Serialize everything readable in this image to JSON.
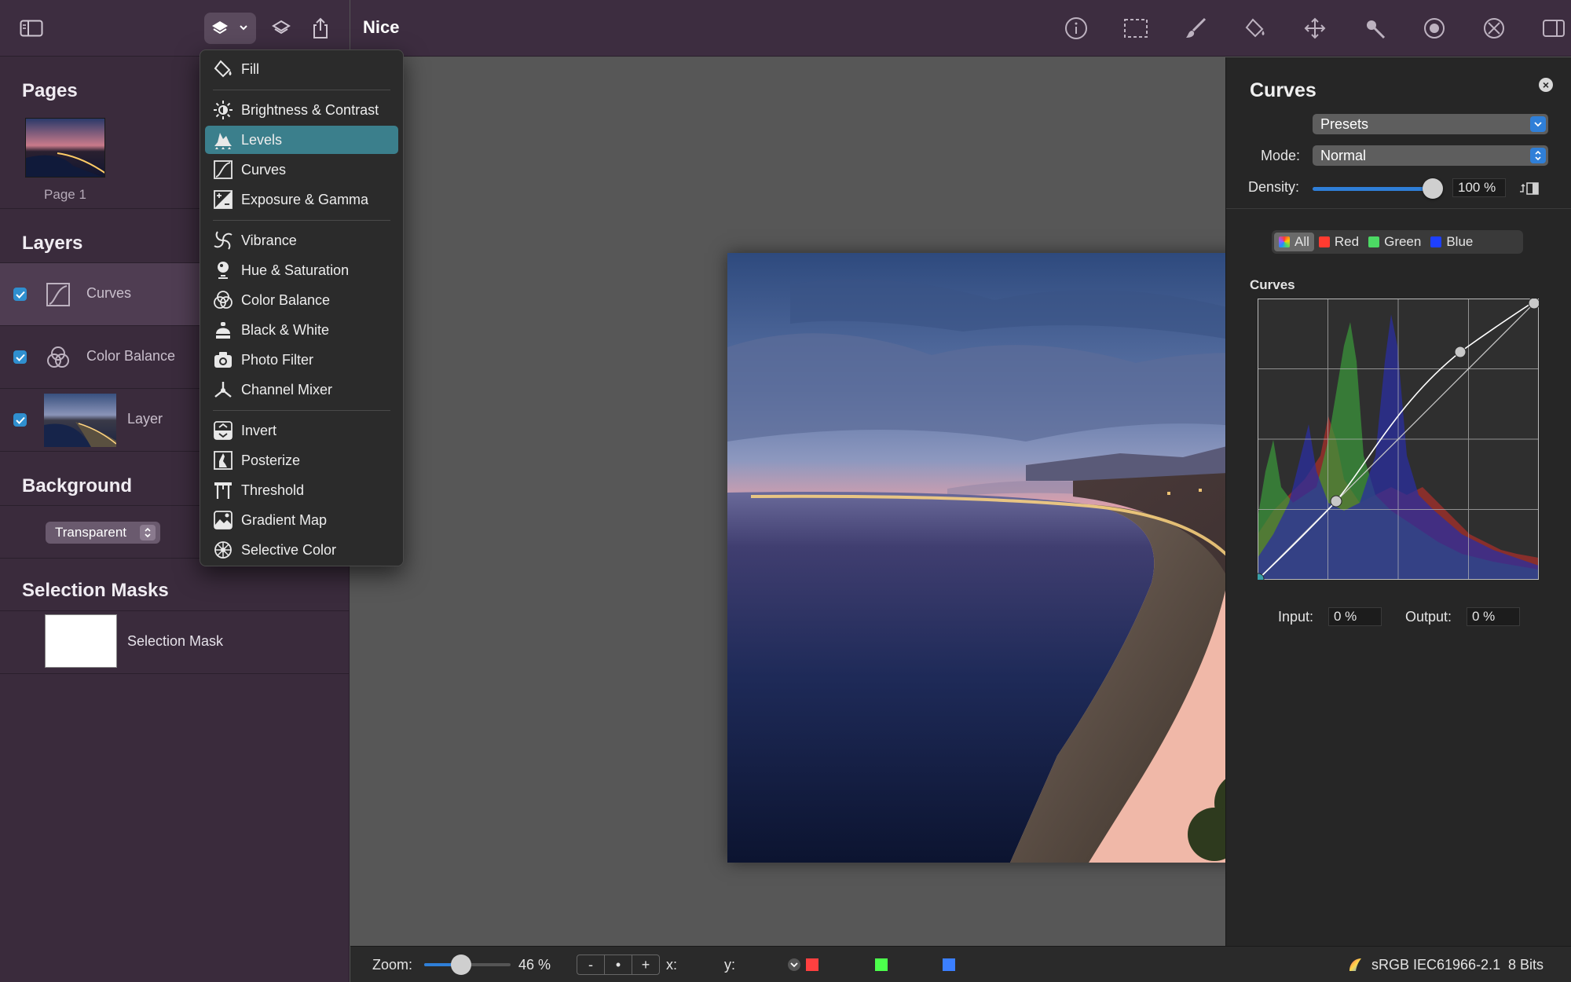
{
  "document": {
    "title": "Nice"
  },
  "sidebar": {
    "pages": {
      "title": "Pages",
      "items": [
        {
          "label": "Page 1"
        }
      ]
    },
    "layers": {
      "title": "Layers",
      "items": [
        {
          "label": "Curves",
          "checked": true,
          "icon": "curves-icon"
        },
        {
          "label": "Color Balance",
          "checked": true,
          "icon": "color-balance-icon"
        },
        {
          "label": "Layer",
          "checked": true,
          "icon": "image-thumbnail"
        }
      ]
    },
    "background": {
      "title": "Background",
      "value": "Transparent"
    },
    "selection_masks": {
      "title": "Selection Masks",
      "items": [
        {
          "label": "Selection Mask"
        }
      ]
    }
  },
  "toolbar": {
    "tools": [
      "info-icon",
      "rect-select-icon",
      "brush-icon",
      "fill-icon",
      "move-icon",
      "magic-wand-icon",
      "mask-icon",
      "transform-icon",
      "inspector-toggle-icon"
    ]
  },
  "menu": {
    "highlighted": "Levels",
    "items": [
      {
        "label": "Fill",
        "icon": "fill-bucket-icon"
      },
      {
        "label": "Brightness & Contrast",
        "icon": "sun-icon"
      },
      {
        "label": "Levels",
        "icon": "levels-icon"
      },
      {
        "label": "Curves",
        "icon": "curves-icon"
      },
      {
        "label": "Exposure & Gamma",
        "icon": "exposure-icon"
      },
      {
        "label": "Vibrance",
        "icon": "vibrance-icon"
      },
      {
        "label": "Hue & Saturation",
        "icon": "hue-icon"
      },
      {
        "label": "Color Balance",
        "icon": "color-balance-icon"
      },
      {
        "label": "Black & White",
        "icon": "black-white-icon"
      },
      {
        "label": "Photo Filter",
        "icon": "camera-icon"
      },
      {
        "label": "Channel Mixer",
        "icon": "channel-mixer-icon"
      },
      {
        "label": "Invert",
        "icon": "invert-icon"
      },
      {
        "label": "Posterize",
        "icon": "posterize-icon"
      },
      {
        "label": "Threshold",
        "icon": "threshold-icon"
      },
      {
        "label": "Gradient Map",
        "icon": "gradient-map-icon"
      },
      {
        "label": "Selective Color",
        "icon": "selective-color-icon"
      }
    ]
  },
  "inspector": {
    "title": "Curves",
    "presets_label": "Presets",
    "mode_label": "Mode:",
    "mode_value": "Normal",
    "density_label": "Density:",
    "density_value": "100 %",
    "density_level": 1.0,
    "channels": [
      {
        "label": "All",
        "color": "#8a8a8a",
        "active": true
      },
      {
        "label": "Red",
        "color": "#ff3b30",
        "active": false
      },
      {
        "label": "Green",
        "color": "#4cd964",
        "active": false
      },
      {
        "label": "Blue",
        "color": "#1e40ff",
        "active": false
      }
    ],
    "curves_label": "Curves",
    "input_label": "Input:",
    "input_value": "0 %",
    "output_label": "Output:",
    "output_value": "0 %"
  },
  "status": {
    "zoom_label": "Zoom:",
    "zoom_value": "46 %",
    "zoom_level": 0.46,
    "zoom_minus": "-",
    "zoom_dot": "•",
    "zoom_plus": "+",
    "x_label": "x:",
    "y_label": "y:",
    "color_profile": "sRGB IEC61966-2.1",
    "bit_depth": "8 Bits",
    "colors": {
      "red": "#ff4040",
      "green": "#4cff4c",
      "blue": "#3b7fff"
    }
  }
}
